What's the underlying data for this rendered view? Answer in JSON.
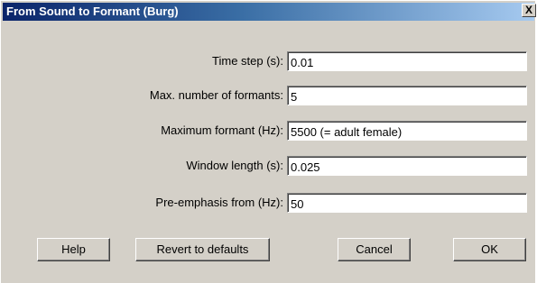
{
  "window": {
    "title": "From Sound to Formant (Burg)",
    "close_glyph": "X"
  },
  "fields": [
    {
      "label": "Time step (s):",
      "value": "0.01"
    },
    {
      "label": "Max. number of formants:",
      "value": "5"
    },
    {
      "label": "Maximum formant (Hz):",
      "value": "5500 (= adult female)"
    },
    {
      "label": "Window length (s):",
      "value": "0.025"
    },
    {
      "label": "Pre-emphasis from (Hz):",
      "value": "50"
    }
  ],
  "buttons": {
    "help": "Help",
    "revert": "Revert to defaults",
    "cancel": "Cancel",
    "ok": "OK"
  }
}
